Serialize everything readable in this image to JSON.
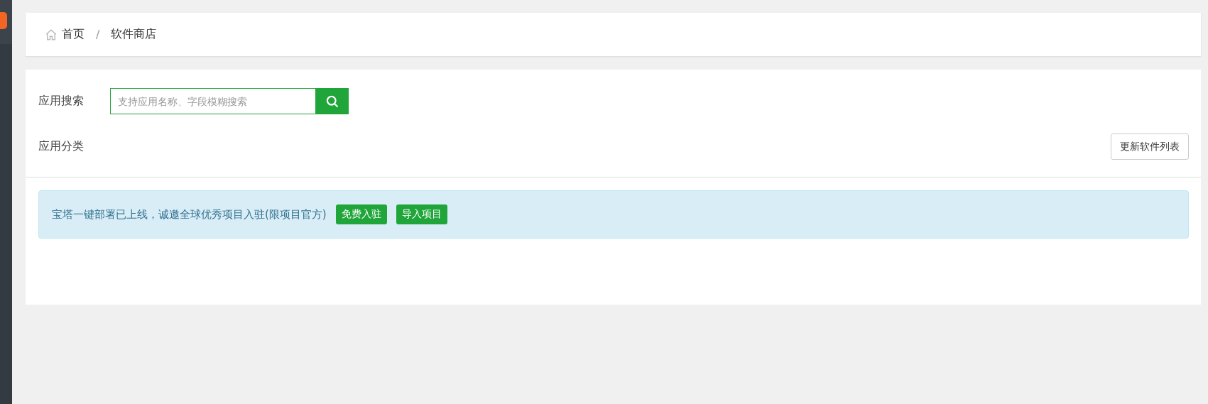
{
  "breadcrumb": [
    {
      "label": "首页",
      "kind": "home"
    },
    {
      "label": "软件商店",
      "kind": "current"
    }
  ],
  "breadcrumb_separator": "/",
  "search": {
    "label": "应用搜索",
    "placeholder": "支持应用名称、字段模糊搜索"
  },
  "category": {
    "label": "应用分类"
  },
  "update_button": "更新软件列表",
  "notice": {
    "text": "宝塔一键部署已上线，诚邀全球优秀项目入驻(限项目官方)",
    "buttons": [
      "免费入驻",
      "导入项目"
    ]
  }
}
